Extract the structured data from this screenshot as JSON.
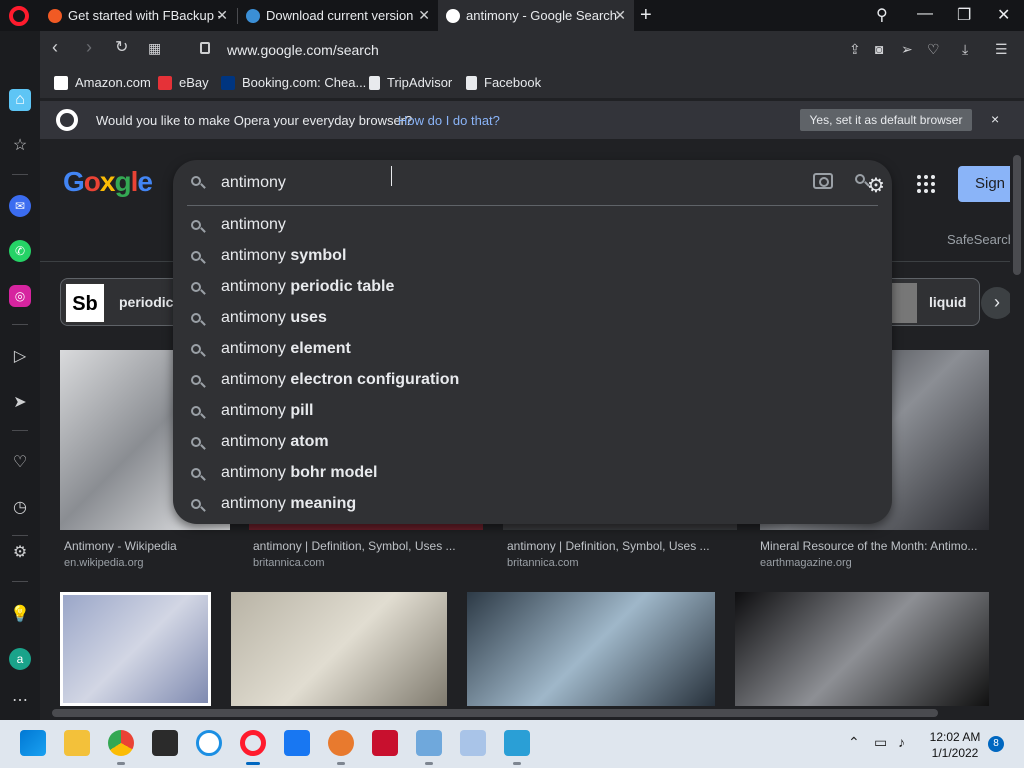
{
  "tabs": [
    {
      "title": "Get started with FBackup -",
      "favicon_color": "#f15a24"
    },
    {
      "title": "Download current version",
      "favicon_color": "#3b8fd6"
    },
    {
      "title": "antimony - Google Search",
      "favicon_color": "#ffffff",
      "active": true
    }
  ],
  "address": {
    "url": "www.google.com/search"
  },
  "bookmarks": [
    {
      "label": "Amazon.com",
      "color": "#ffffff"
    },
    {
      "label": "eBay",
      "color": "#e53238"
    },
    {
      "label": "Booking.com: Chea...",
      "color": "#003580"
    },
    {
      "label": "TripAdvisor",
      "color": "#e8eaed"
    },
    {
      "label": "Facebook",
      "color": "#e8eaed"
    }
  ],
  "banner": {
    "text": "Would you like to make Opera your everyday browser?",
    "link": "How do I do that?",
    "button": "Yes, set it as default browser",
    "close": "×"
  },
  "google": {
    "sign_in": "Sign",
    "safesearch": "SafeSearch",
    "query": "antimony",
    "chips": [
      {
        "label": "periodic"
      },
      {
        "label": "liquid"
      }
    ],
    "chip_sb": "Sb",
    "suggestions": [
      {
        "base": "antimony",
        "bold": ""
      },
      {
        "base": "antimony",
        "bold": " symbol"
      },
      {
        "base": "antimony",
        "bold": " periodic table"
      },
      {
        "base": "antimony",
        "bold": " uses"
      },
      {
        "base": "antimony",
        "bold": " element"
      },
      {
        "base": "antimony",
        "bold": " electron configuration"
      },
      {
        "base": "antimony",
        "bold": " pill"
      },
      {
        "base": "antimony",
        "bold": " atom"
      },
      {
        "base": "antimony",
        "bold": " bohr model"
      },
      {
        "base": "antimony",
        "bold": " meaning"
      }
    ],
    "results": [
      {
        "title": "Antimony - Wikipedia",
        "source": "en.wikipedia.org"
      },
      {
        "title": "antimony | Definition, Symbol, Uses ...",
        "source": "britannica.com"
      },
      {
        "title": "antimony | Definition, Symbol, Uses ...",
        "source": "britannica.com"
      },
      {
        "title": "Mineral Resource of the Month: Antimo...",
        "source": "earthmagazine.org"
      }
    ]
  },
  "taskbar": {
    "time": "12:02 AM",
    "date": "1/1/2022",
    "notifications": "8"
  }
}
